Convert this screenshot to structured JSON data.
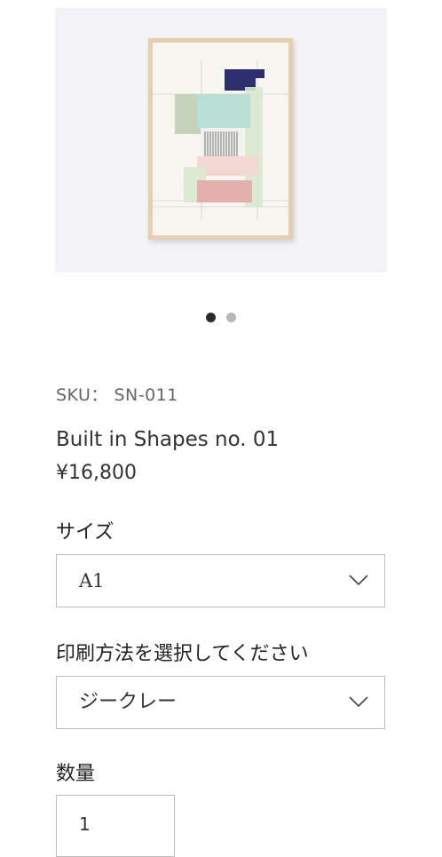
{
  "product": {
    "sku_label": "SKU：",
    "sku": "SN-011",
    "title": "Built in Shapes no. 01",
    "price": "¥16,800"
  },
  "gallery": {
    "image_count": 2,
    "active_index": 0
  },
  "size_select": {
    "label": "サイズ",
    "value": "A1"
  },
  "print_select": {
    "label": "印刷方法を選択してください",
    "value": "ジークレー"
  },
  "quantity": {
    "label": "数量",
    "value": "1"
  },
  "colors": {
    "frame": "#e6cfb1",
    "navy": "#2d2f6e",
    "mint": "#b9dfd4",
    "sage": "#c5d3ba",
    "rose": "#e3b1ab",
    "light_green": "#d9e9cf"
  },
  "icons": {
    "dropdown": "chevron-down-icon"
  }
}
